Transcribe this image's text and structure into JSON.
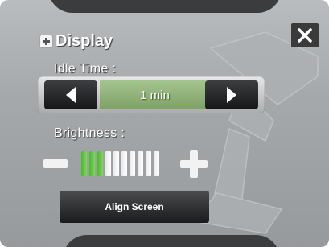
{
  "dialog": {
    "title": "Display",
    "close_icon": "close-icon"
  },
  "idle_time": {
    "label": "Idle Time :",
    "value": "1 min"
  },
  "brightness": {
    "label": "Brightness :",
    "level": 3,
    "max_level": 10
  },
  "align_screen": {
    "label": "Align Screen"
  },
  "colors": {
    "panel": "#a5a8aa",
    "dark_button": "#1a1b1c",
    "value_green": "#8cb076",
    "level_on": "#5cc637",
    "level_off": "#f0f0f0"
  }
}
